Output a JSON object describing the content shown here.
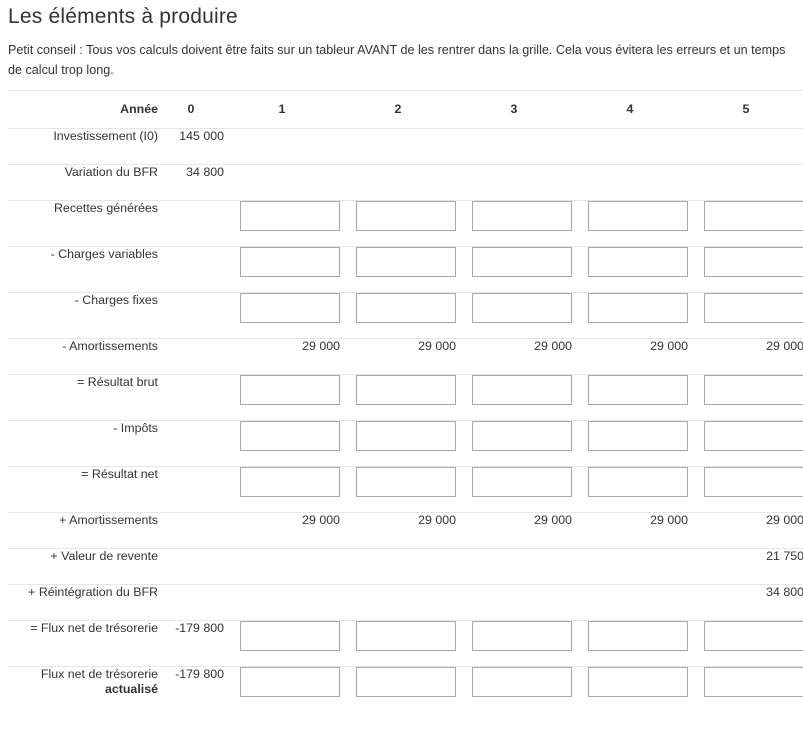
{
  "title": "Les éléments à produire",
  "tip": "Petit conseil : Tous vos calculs doivent être faits sur un tableur AVANT de les rentrer dans la grille. Cela vous évitera les erreurs et un temps de calcul trop long.",
  "header": {
    "label": "Année",
    "years": [
      "0",
      "1",
      "2",
      "3",
      "4",
      "5"
    ]
  },
  "rows": {
    "investissement": {
      "label": "Investissement (I0)",
      "zero": "145 000"
    },
    "bfr": {
      "label": "Variation du BFR",
      "zero": "34 800"
    },
    "recettes": {
      "label": "Recettes générées"
    },
    "charges_variables": {
      "label": "- Charges variables"
    },
    "charges_fixes": {
      "label": "- Charges fixes"
    },
    "amortissements": {
      "label": "- Amortissements",
      "values": [
        "29 000",
        "29 000",
        "29 000",
        "29 000",
        "29 000"
      ]
    },
    "resultat_brut": {
      "label": "= Résultat brut"
    },
    "impots": {
      "label": "- Impôts"
    },
    "resultat_net": {
      "label": "= Résultat net"
    },
    "plus_amortissements": {
      "label": "+ Amortissements",
      "values": [
        "29 000",
        "29 000",
        "29 000",
        "29 000",
        "29 000"
      ]
    },
    "valeur_revente": {
      "label": "+ Valeur de revente",
      "year5": "21 750"
    },
    "reintegration_bfr": {
      "label": "+ Réintégration du BFR",
      "year5": "34 800"
    },
    "flux_net": {
      "label": "= Flux net de trésorerie",
      "zero": "-179 800"
    },
    "flux_actualise": {
      "label_line1": "Flux net de trésorerie",
      "label_line2": "actualisé",
      "zero": "-179 800"
    }
  }
}
